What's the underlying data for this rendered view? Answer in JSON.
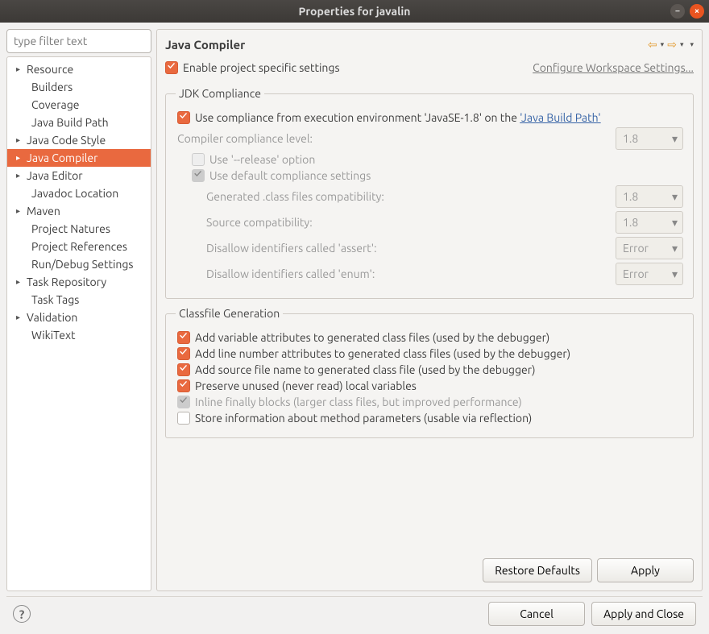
{
  "window": {
    "title": "Properties for javalin"
  },
  "filter": {
    "placeholder": "type filter text"
  },
  "tree": [
    {
      "label": "Resource",
      "expand": true,
      "indent": 0
    },
    {
      "label": "Builders",
      "expand": false,
      "indent": 1
    },
    {
      "label": "Coverage",
      "expand": false,
      "indent": 1
    },
    {
      "label": "Java Build Path",
      "expand": false,
      "indent": 1
    },
    {
      "label": "Java Code Style",
      "expand": true,
      "indent": 0
    },
    {
      "label": "Java Compiler",
      "expand": true,
      "indent": 0,
      "selected": true
    },
    {
      "label": "Java Editor",
      "expand": true,
      "indent": 0
    },
    {
      "label": "Javadoc Location",
      "expand": false,
      "indent": 1
    },
    {
      "label": "Maven",
      "expand": true,
      "indent": 0
    },
    {
      "label": "Project Natures",
      "expand": false,
      "indent": 1
    },
    {
      "label": "Project References",
      "expand": false,
      "indent": 1
    },
    {
      "label": "Run/Debug Settings",
      "expand": false,
      "indent": 1
    },
    {
      "label": "Task Repository",
      "expand": true,
      "indent": 0
    },
    {
      "label": "Task Tags",
      "expand": false,
      "indent": 1
    },
    {
      "label": "Validation",
      "expand": true,
      "indent": 0
    },
    {
      "label": "WikiText",
      "expand": false,
      "indent": 1
    }
  ],
  "page": {
    "title": "Java Compiler",
    "enable_specific": "Enable project specific settings",
    "configure_link": "Configure Workspace Settings..."
  },
  "jdk": {
    "legend": "JDK Compliance",
    "use_compliance_prefix": "Use compliance from execution environment 'JavaSE-1.8' on the ",
    "build_path_link": "'Java Build Path'",
    "compiler_level_label": "Compiler compliance level:",
    "compiler_level_value": "1.8",
    "use_release": "Use '--release' option",
    "use_default": "Use default compliance settings",
    "generated_label": "Generated .class files compatibility:",
    "generated_value": "1.8",
    "source_label": "Source compatibility:",
    "source_value": "1.8",
    "assert_label": "Disallow identifiers called 'assert':",
    "assert_value": "Error",
    "enum_label": "Disallow identifiers called 'enum':",
    "enum_value": "Error"
  },
  "classfile": {
    "legend": "Classfile Generation",
    "var_attr": "Add variable attributes to generated class files (used by the debugger)",
    "line_attr": "Add line number attributes to generated class files (used by the debugger)",
    "source_file": "Add source file name to generated class file (used by the debugger)",
    "preserve_unused": "Preserve unused (never read) local variables",
    "inline_finally": "Inline finally blocks (larger class files, but improved performance)",
    "store_params": "Store information about method parameters (usable via reflection)"
  },
  "buttons": {
    "restore": "Restore Defaults",
    "apply": "Apply",
    "cancel": "Cancel",
    "apply_close": "Apply and Close"
  }
}
